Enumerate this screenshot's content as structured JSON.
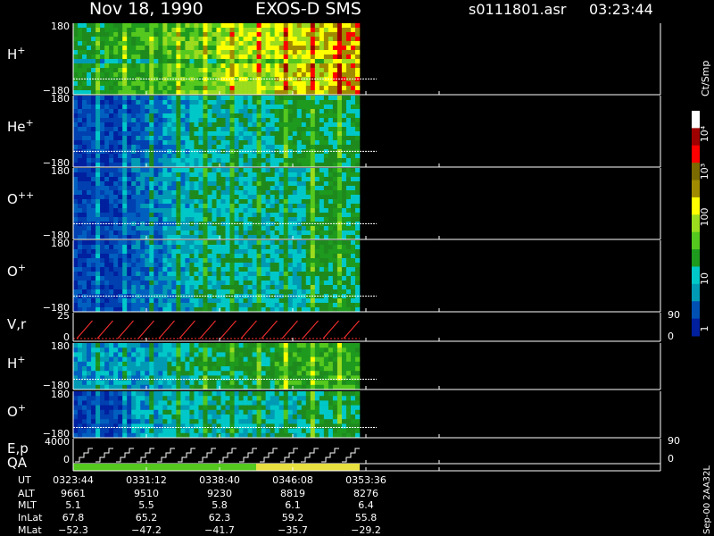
{
  "header": {
    "date": "Nov 18, 1990",
    "mission": "EXOS-D SMS",
    "file": "s0111801.asr",
    "time": "03:23:44"
  },
  "colorbar": {
    "unit_label": "Ct/Smp",
    "tick_labels": [
      "10⁴",
      "10³",
      "100",
      "10",
      "1"
    ],
    "colors": [
      "#ffffff",
      "#9e0000",
      "#ff0000",
      "#7a6a00",
      "#a08a00",
      "#ffff00",
      "#9bdc1e",
      "#54c81e",
      "#1e9a1e",
      "#00c8c8",
      "#009ab4",
      "#0050b4",
      "#0020a0"
    ]
  },
  "footer": {
    "row_labels": [
      "UT",
      "ALT",
      "MLT",
      "InLat",
      "MLat"
    ],
    "columns": [
      [
        "0323:44",
        "9661",
        "5.1",
        "67.8",
        "−52.3"
      ],
      [
        "0331:12",
        "9510",
        "5.5",
        "65.2",
        "−47.2"
      ],
      [
        "0338:40",
        "9230",
        "5.8",
        "62.3",
        "−41.7"
      ],
      [
        "0346:08",
        "8819",
        "6.1",
        "59.2",
        "−35.7"
      ],
      [
        "0353:36",
        "8276",
        "6.4",
        "55.8",
        "−29.2"
      ]
    ],
    "side_text": "Sep-00  2AA32L"
  },
  "chart_data": {
    "type": "heatmap",
    "x": [
      "0323:44",
      "0331:12",
      "0338:40",
      "0346:08",
      "0353:36"
    ],
    "panels": [
      {
        "label": "H+",
        "ymax": "180",
        "ymin": "−180",
        "level": [
          5,
          6,
          6,
          7,
          7,
          8,
          8,
          9,
          9,
          10
        ]
      },
      {
        "label": "He+",
        "ymax": "180",
        "ymin": "−180",
        "level": [
          1,
          1,
          2,
          3,
          4,
          4,
          4,
          5,
          5,
          5
        ]
      },
      {
        "label": "O++",
        "ymax": "180",
        "ymin": "−180",
        "level": [
          1,
          1,
          2,
          3,
          4,
          4,
          4,
          4,
          5,
          5
        ]
      },
      {
        "label": "O+",
        "ymax": "180",
        "ymin": "−180",
        "level": [
          1,
          1,
          2,
          3,
          4,
          4,
          4,
          4,
          5,
          5
        ]
      },
      {
        "label": "V,r",
        "ymax": "25",
        "ymin": "0",
        "right_labels": [
          "90",
          "0"
        ]
      },
      {
        "label": "H+",
        "ymax": "180",
        "ymin": "−180",
        "level": [
          3,
          3,
          3,
          4,
          5,
          5,
          5,
          6,
          6,
          6
        ]
      },
      {
        "label": "O+",
        "ymax": "180",
        "ymin": "−180",
        "level": [
          1,
          1,
          3,
          4,
          4,
          4,
          4,
          4,
          5,
          5
        ]
      },
      {
        "label": "E,p",
        "ymax": "4000",
        "ymin": "0",
        "right_labels": [
          "90",
          "0"
        ]
      },
      {
        "label": "QA"
      }
    ]
  }
}
